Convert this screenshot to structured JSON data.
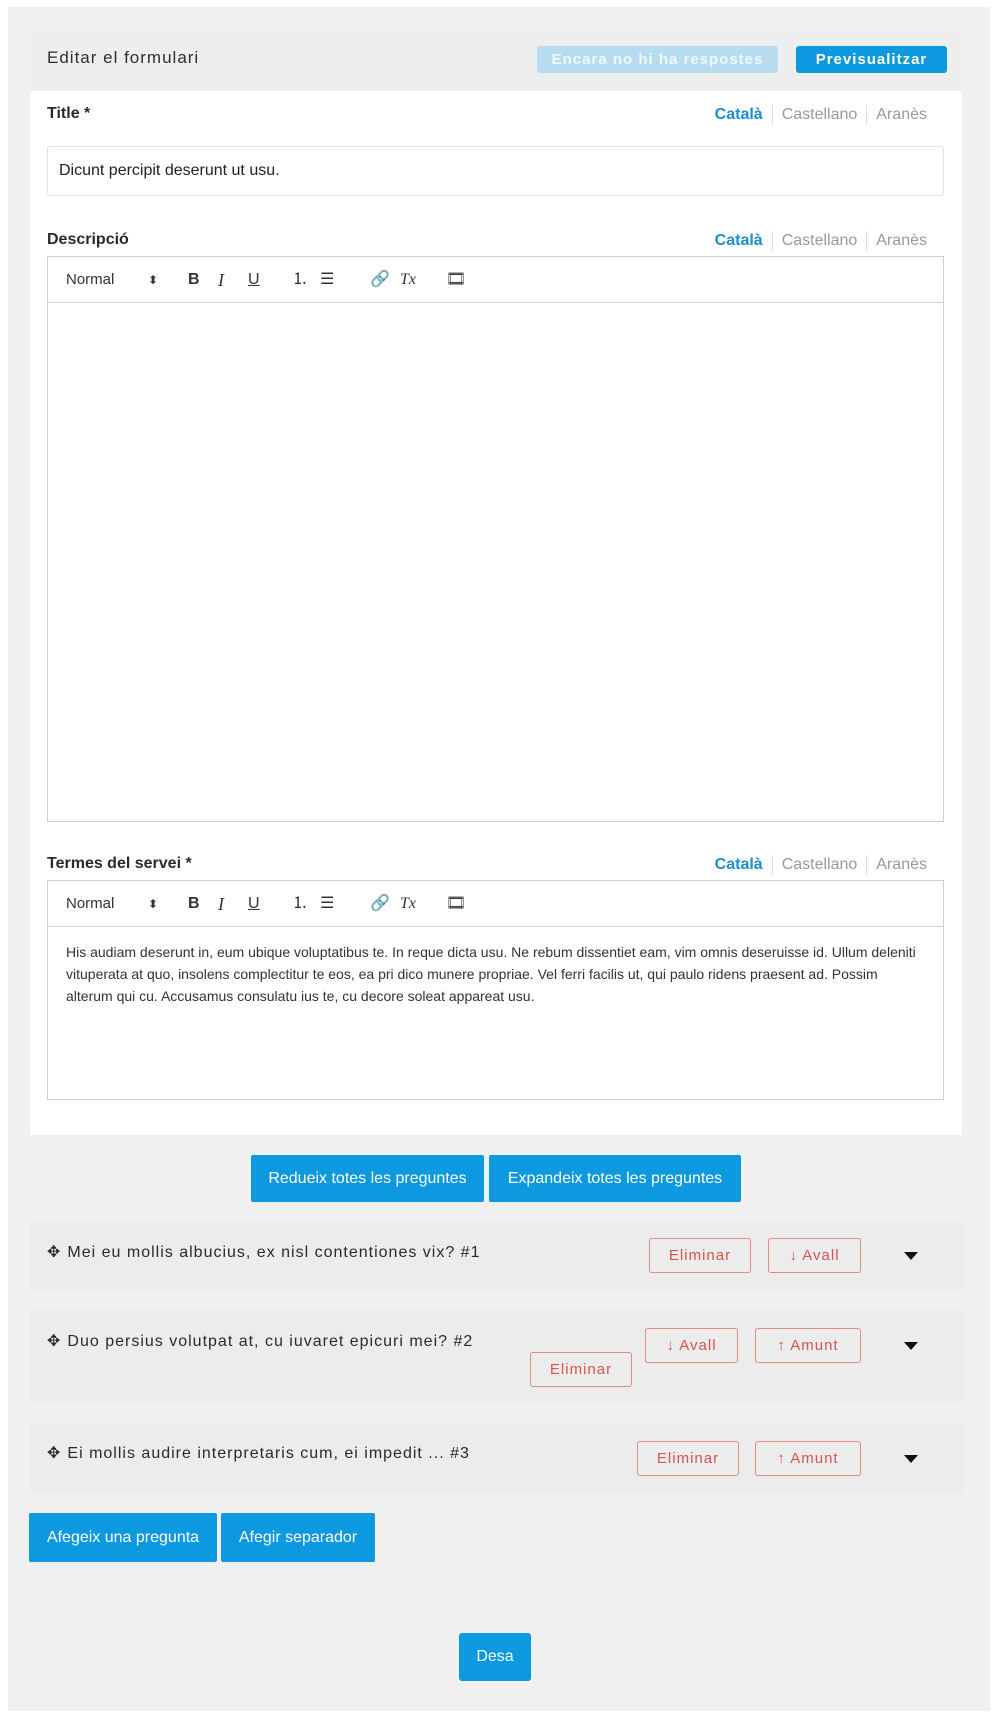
{
  "header": {
    "title": "Editar el formulari",
    "no_answers_label": "Encara no hi ha respostes",
    "preview_label": "Previsualitzar"
  },
  "languages": [
    "Català",
    "Castellano",
    "Aranès"
  ],
  "title_field": {
    "label": "Title *",
    "value": "Dicunt percipit deserunt ut usu."
  },
  "description_field": {
    "label": "Descripció",
    "content": ""
  },
  "terms_field": {
    "label": "Termes del servei *",
    "content": "His audiam deserunt in, eum ubique voluptatibus te. In reque dicta usu. Ne rebum dissentiet eam, vim omnis deseruisse id. Ullum deleniti vituperata at quo, insolens complectitur te eos, ea pri dico munere propriae. Vel ferri facilis ut, qui paulo ridens praesent ad. Possim alterum qui cu. Accusamus consulatu ius te, cu decore soleat appareat usu."
  },
  "toolbar": {
    "format_label": "Normal",
    "format_arrows": "⬍",
    "bold": "B",
    "italic": "I",
    "underline": "U",
    "ordered_list": "⒈",
    "bullet_list": "☰",
    "link": "🔗",
    "clean": "Tx",
    "video": "🎞"
  },
  "actions": {
    "collapse_all": "Redueix totes les preguntes",
    "expand_all": "Expandeix totes les preguntes",
    "add_question": "Afegeix una pregunta",
    "add_separator": "Afegir separador",
    "save": "Desa"
  },
  "questions": [
    {
      "title": "Mei eu mollis albucius, ex nisl contentiones vix? #1",
      "delete_label": "Eliminar",
      "down_label": "Avall"
    },
    {
      "title": "Duo persius volutpat at, cu iuvaret epicuri mei? #2",
      "delete_label": "Eliminar",
      "down_label": "Avall",
      "up_label": "Amunt"
    },
    {
      "title": "Ei mollis audire interpretaris cum, ei impedit ... #3",
      "delete_label": "Eliminar",
      "up_label": "Amunt"
    }
  ],
  "icons": {
    "move": "✥",
    "arrow_down": "↓",
    "arrow_up": "↑"
  },
  "colors": {
    "primary": "#0d99e0",
    "primary_disabled": "#b7dcf0",
    "danger": "#d9534f",
    "active_lang": "#1a8fd0"
  }
}
